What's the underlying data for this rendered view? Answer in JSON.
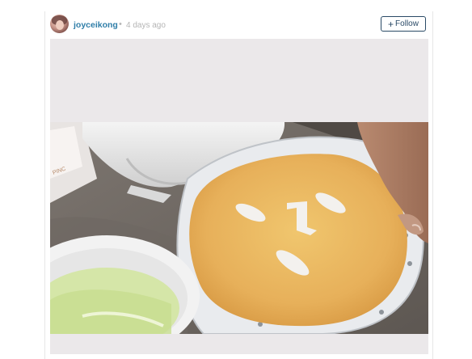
{
  "post": {
    "username": "joyceikong",
    "separator": "•",
    "timestamp": "4 days ago",
    "follow": {
      "icon": "plus-icon",
      "label": "Follow"
    }
  },
  "colors": {
    "username": "#2f7ea8",
    "follow_border": "#2a4a66",
    "media_background": "#ebe8ea"
  }
}
